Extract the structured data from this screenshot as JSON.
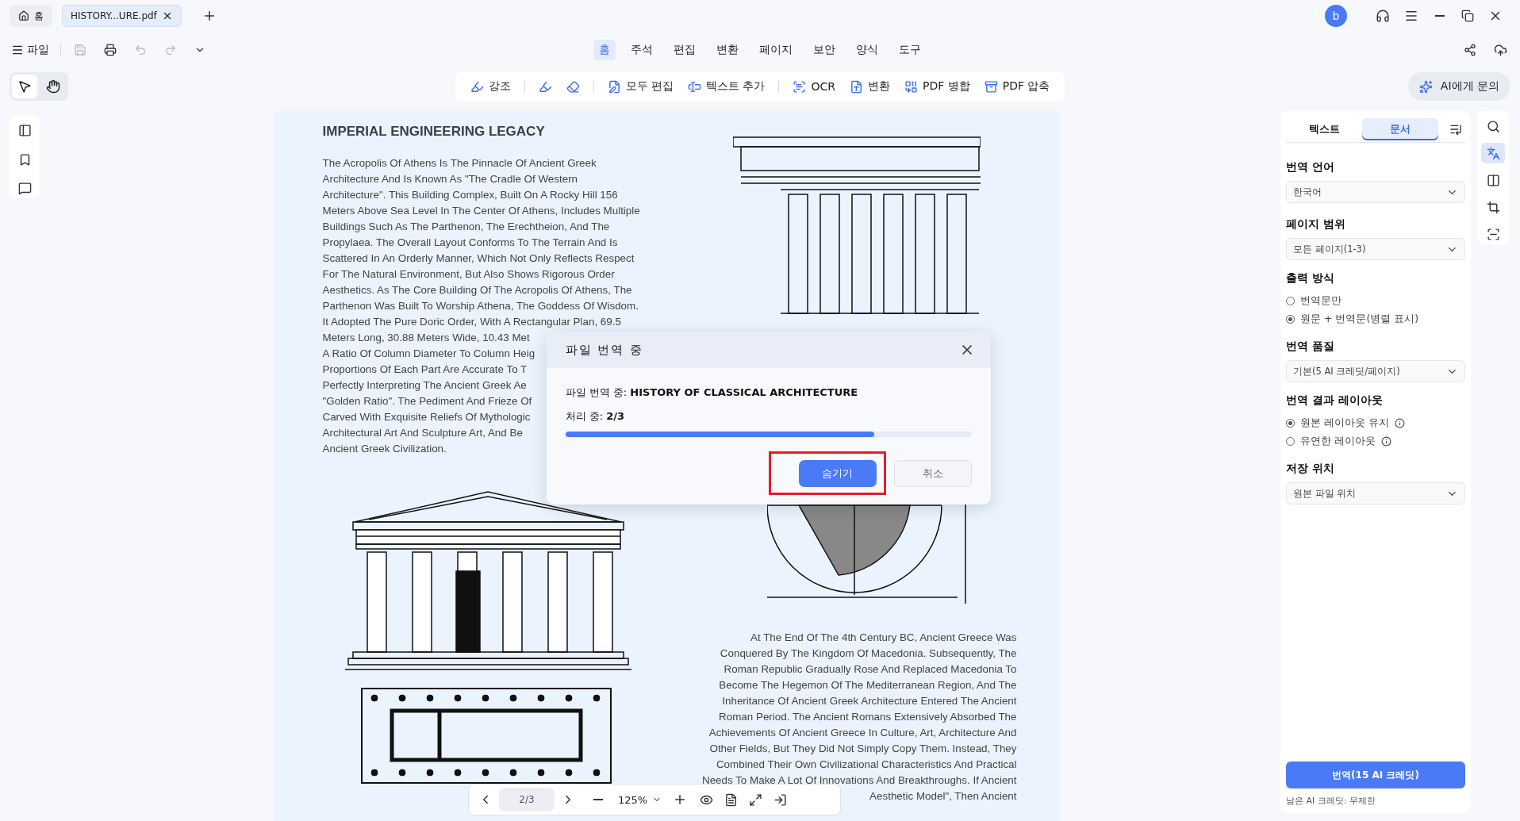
{
  "app_tabs": [
    {
      "kind": "home",
      "label": "홈",
      "selected": false
    },
    {
      "kind": "file",
      "label": "HISTORY...URE.pdf",
      "selected": true
    }
  ],
  "account": {
    "initial": "b"
  },
  "menu": {
    "label": "파일"
  },
  "ribbon_tabs": [
    {
      "label": "홈",
      "selected": true
    },
    {
      "label": "주석",
      "selected": false
    },
    {
      "label": "편집",
      "selected": false
    },
    {
      "label": "변환",
      "selected": false
    },
    {
      "label": "페이지",
      "selected": false
    },
    {
      "label": "보안",
      "selected": false
    },
    {
      "label": "양식",
      "selected": false
    },
    {
      "label": "도구",
      "selected": false
    }
  ],
  "pointer_tools": [
    {
      "kind": "select",
      "selected": true
    },
    {
      "kind": "hand",
      "selected": false
    }
  ],
  "toolbar": [
    {
      "label": "강조"
    },
    {
      "label": "모두 편집"
    },
    {
      "label": "텍스트 추가"
    },
    {
      "label": "OCR"
    },
    {
      "label": "변환"
    },
    {
      "label": "PDF 병합"
    },
    {
      "label": "PDF 압축"
    }
  ],
  "ai_button": "AI에게 문의",
  "document": {
    "heading": "IMPERIAL ENGINEERING LEGACY",
    "left_lines": [
      "The Acropolis Of Athens Is The Pinnacle Of Ancient Greek",
      "Architecture And Is Known As \"The Cradle Of Western",
      "Architecture\". This Building Complex, Built On A Rocky Hill 156",
      "Meters Above Sea Level In The Center Of Athens, Includes Multiple",
      "Buildings Such As The Parthenon, The Erechtheion, And The",
      "Propylaea. The Overall Layout Conforms To The Terrain And Is",
      "Scattered In An Orderly Manner, Which Not Only Reflects Respect",
      "For The Natural Environment, But Also Shows Rigorous Order",
      "Aesthetics. As The Core Building Of The Acropolis Of Athens, The",
      "Parthenon Was Built To Worship Athena, The Goddess Of Wisdom.",
      "It Adopted The Pure Doric Order, With A Rectangular Plan, 69.5",
      "Meters Long, 30.88 Meters Wide, 10.43 Met",
      "A Ratio Of Column Diameter To Column Heig",
      "Proportions Of Each Part Are Accurate To T",
      "Perfectly Interpreting The Ancient Greek Ae",
      "\"Golden Ratio\". The Pediment And Frieze Of",
      "Carved With Exquisite Reliefs Of Mythologic",
      "Architectural Art And Sculpture Art, And Be",
      "Ancient Greek Civilization."
    ],
    "right_lines": [
      "At The End Of The 4th Century BC, Ancient Greece Was",
      "Conquered By The Kingdom Of Macedonia. Subsequently, The",
      "Roman Republic Gradually Rose And Replaced Macedonia To",
      "Become The Hegemon Of The Mediterranean Region, And The",
      "Inheritance Of Ancient Greek Architecture Entered The Ancient",
      "Roman Period. The Ancient Romans Extensively Absorbed The",
      "Achievements Of Ancient Greece In Culture, Art, Architecture And",
      "Other Fields, But They Did Not Simply Copy Them. Instead, They",
      "Combined Their Own Civilizational Characteristics And Practical",
      "Needs To Make A Lot Of Innovations And Breakthroughs. If Ancient",
      "Aesthetic Model\", Then Ancient"
    ]
  },
  "dialog": {
    "title": "파일 번역 중",
    "file_line": "파일 번역 중: **HISTORY OF CLASSICAL ARCHITECTURE**",
    "progress_line": "처리 중: **2/3**",
    "level": 0.76,
    "buttons": [
      {
        "kind": "primary",
        "label": "숨기기",
        "highlighted": true
      },
      {
        "kind": "secondary",
        "label": "취소",
        "highlighted": false
      }
    ]
  },
  "pager": {
    "page": "2/3",
    "zoom": "125%"
  },
  "panel": {
    "tabs": [
      {
        "label": "텍스트",
        "selected": false
      },
      {
        "label": "문서",
        "selected": true
      }
    ],
    "sections": [
      {
        "kind": "select",
        "title": "번역 언어",
        "value": "한국어"
      },
      {
        "kind": "select",
        "title": "페이지 범위",
        "value": "모든 페이지(1-3)"
      },
      {
        "kind": "radio",
        "title": "출력 방식",
        "options": [
          {
            "label": "번역문만",
            "selected": false
          },
          {
            "label": "원문 + 번역문(병렬 표시)",
            "selected": true
          }
        ]
      },
      {
        "kind": "select",
        "title": "번역 품질",
        "value": "기본(5 AI 크레딧/페이지)"
      },
      {
        "kind": "radio",
        "title": "번역 결과 레이아웃",
        "options": [
          {
            "label": "원본 레이아웃 유지",
            "selected": true,
            "info": true
          },
          {
            "label": "유연한 레이아웃",
            "selected": false,
            "info": true
          }
        ]
      },
      {
        "kind": "select",
        "title": "저장 위치",
        "value": "원본 파일 위치"
      }
    ],
    "action": "번역(15 AI 크레딧)",
    "note": "남은 AI 크레딧: 무제한"
  }
}
